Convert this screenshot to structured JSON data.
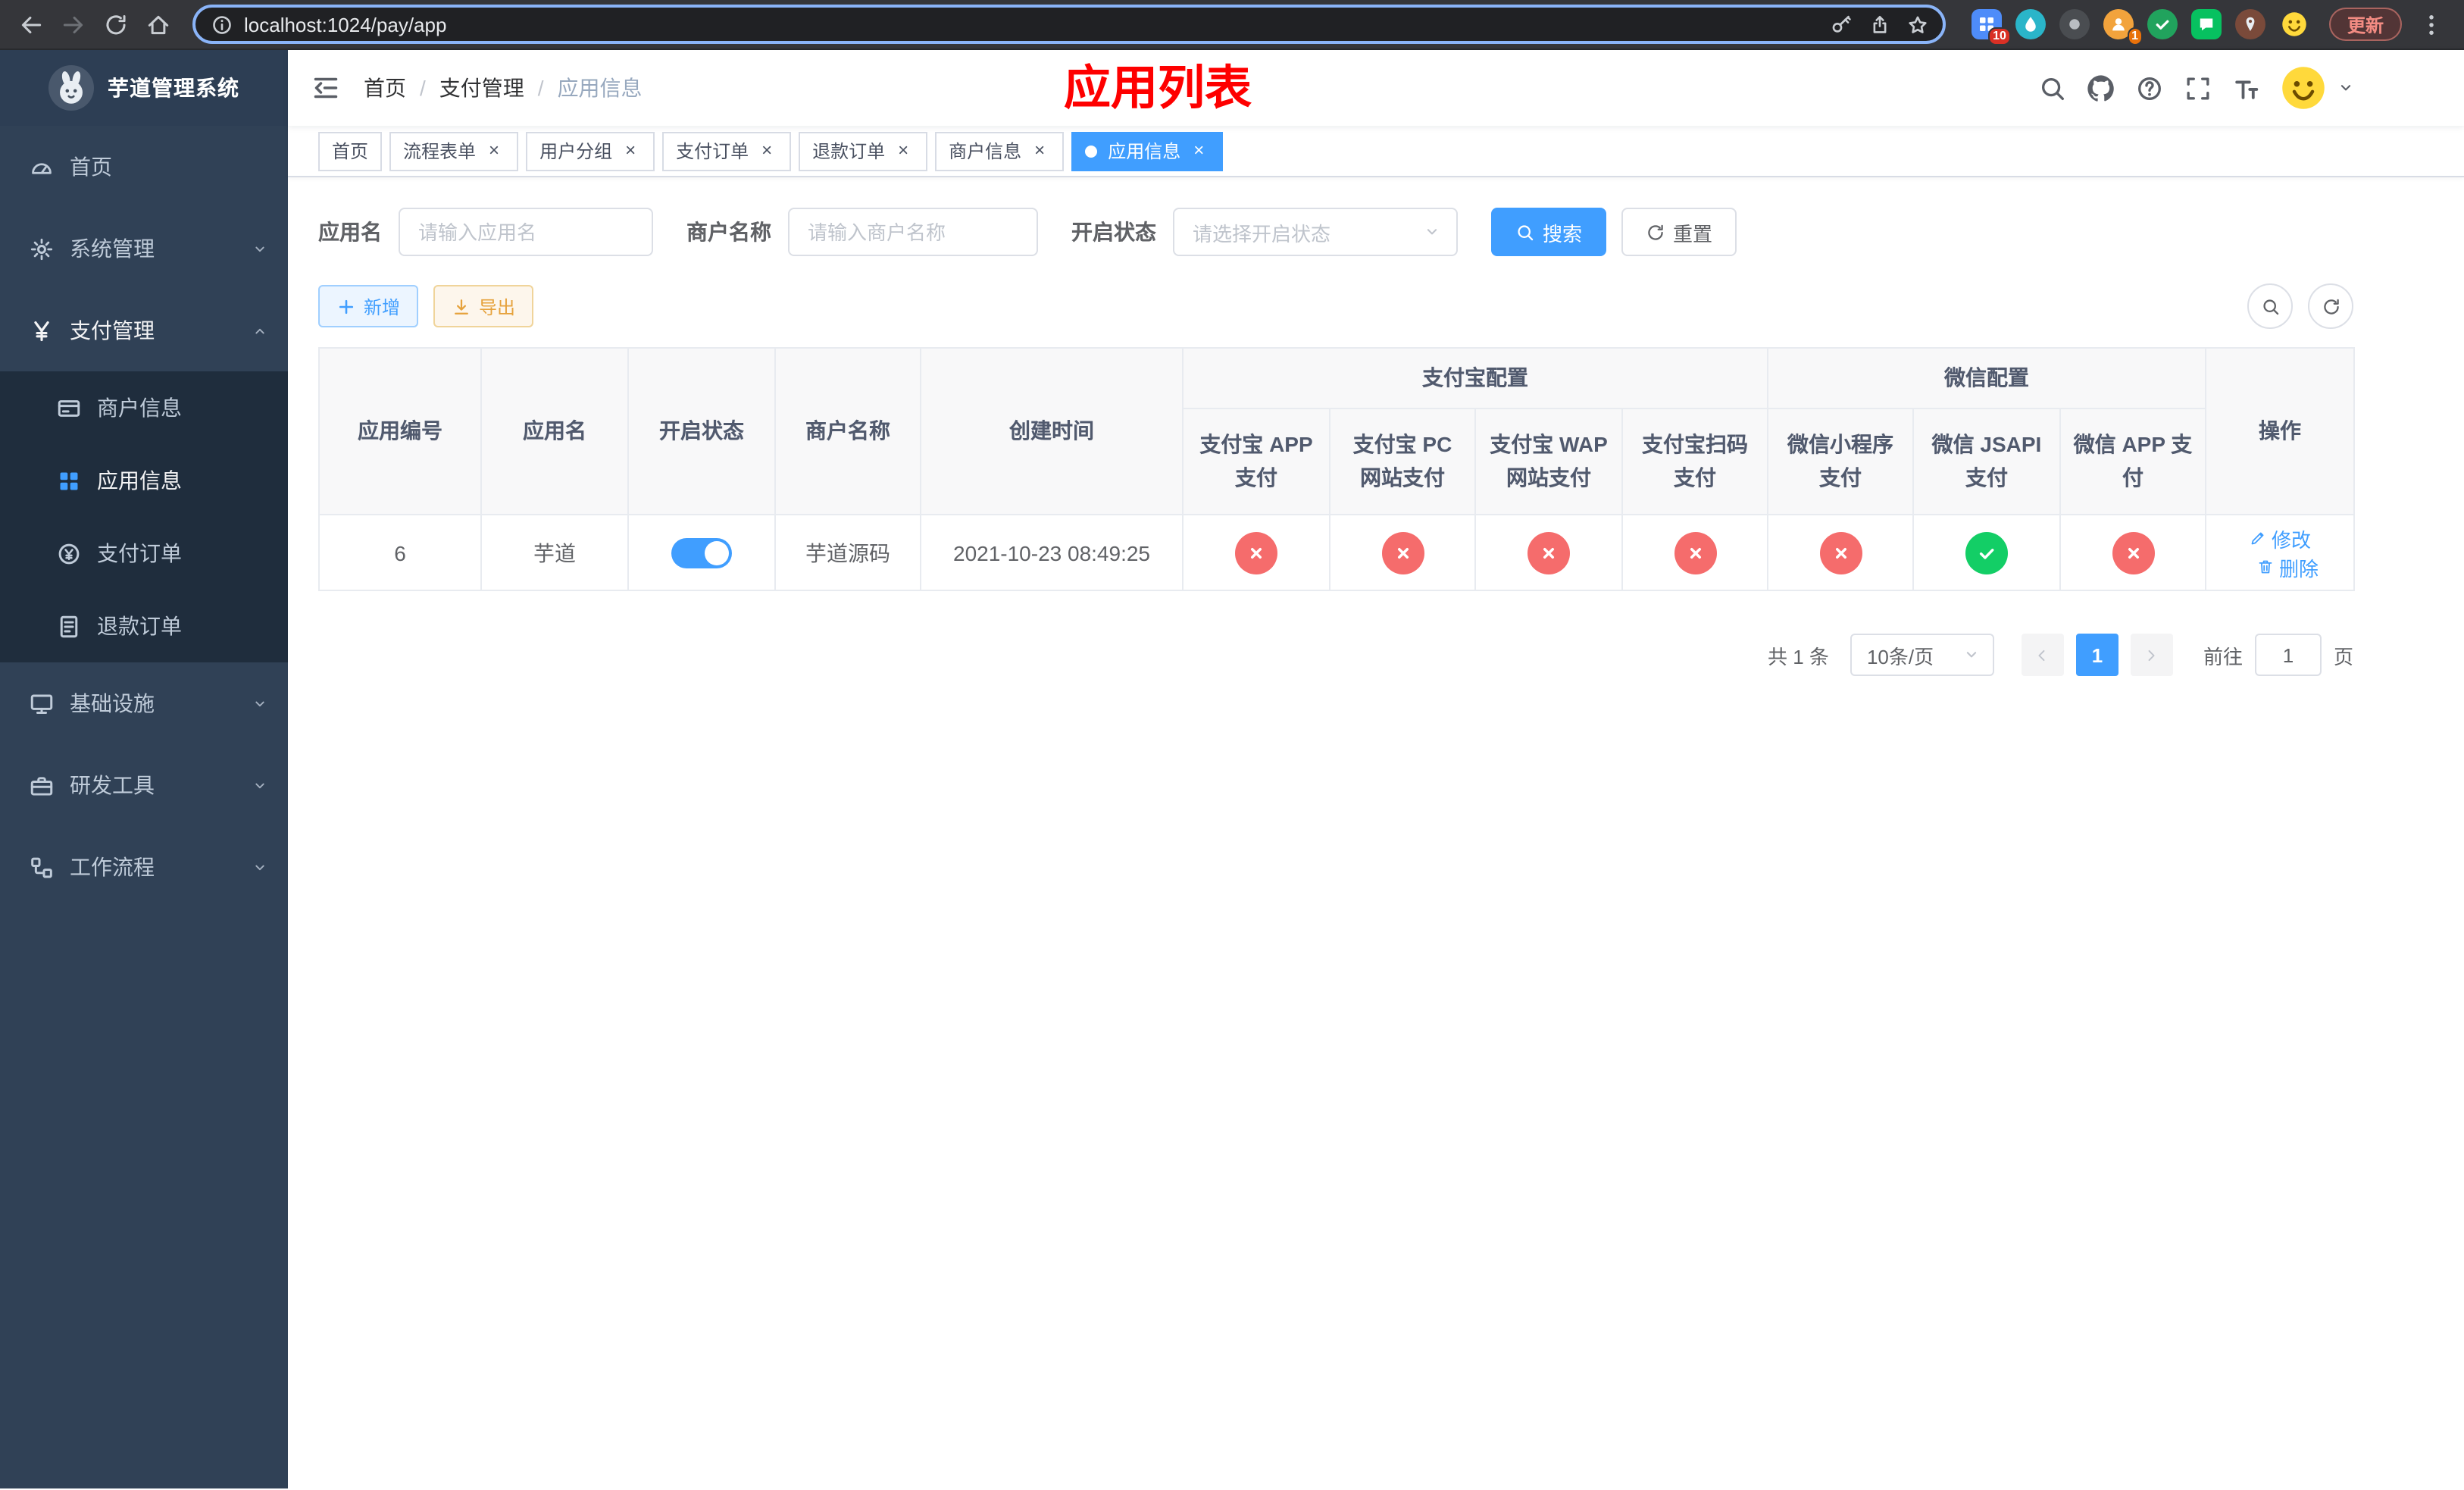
{
  "browser": {
    "url": "localhost:1024/pay/app",
    "update_label": "更新",
    "extensions": [
      {
        "id": "grid",
        "color": "#4e8cf9",
        "shape": "square",
        "badge": "10",
        "badge_color": "#d93025"
      },
      {
        "id": "drop",
        "color": "#2ab5c9",
        "shape": "circle"
      },
      {
        "id": "dark",
        "color": "#4a4d51",
        "shape": "circle"
      },
      {
        "id": "avatar",
        "color": "#f2a33c",
        "shape": "circle",
        "badge": "1",
        "badge_color": "#e8710a"
      },
      {
        "id": "check",
        "color": "#21a35d",
        "shape": "circle"
      },
      {
        "id": "chat",
        "color": "#07c160",
        "shape": "square"
      },
      {
        "id": "pin",
        "color": "#7a4a3a",
        "shape": "circle"
      },
      {
        "id": "smiley",
        "color": "transparent",
        "shape": "circle"
      }
    ]
  },
  "sidebar": {
    "logo_title": "芋道管理系统",
    "items": [
      {
        "id": "home",
        "label": "首页",
        "icon": "dashboard",
        "type": "item"
      },
      {
        "id": "system",
        "label": "系统管理",
        "icon": "gear",
        "type": "group",
        "expanded": false
      },
      {
        "id": "payment",
        "label": "支付管理",
        "icon": "yen",
        "type": "group",
        "expanded": true,
        "children": [
          {
            "id": "merchant-info",
            "label": "商户信息",
            "icon": "card",
            "active": false
          },
          {
            "id": "app-info",
            "label": "应用信息",
            "icon": "grid",
            "active": true
          },
          {
            "id": "pay-order",
            "label": "支付订单",
            "icon": "order",
            "active": false
          },
          {
            "id": "refund-order",
            "label": "退款订单",
            "icon": "doc",
            "active": false
          }
        ]
      },
      {
        "id": "infra",
        "label": "基础设施",
        "icon": "monitor",
        "type": "group",
        "expanded": false
      },
      {
        "id": "devtools",
        "label": "研发工具",
        "icon": "tool",
        "type": "group",
        "expanded": false
      },
      {
        "id": "workflow",
        "label": "工作流程",
        "icon": "flow",
        "type": "group",
        "expanded": false
      }
    ]
  },
  "header": {
    "breadcrumb": [
      "首页",
      "支付管理",
      "应用信息"
    ],
    "separator": "/",
    "page_title": "应用列表"
  },
  "tabs": [
    {
      "id": "home",
      "label": "首页",
      "closable": false,
      "active": false
    },
    {
      "id": "process-form",
      "label": "流程表单",
      "closable": true,
      "active": false
    },
    {
      "id": "user-group",
      "label": "用户分组",
      "closable": true,
      "active": false
    },
    {
      "id": "pay-order",
      "label": "支付订单",
      "closable": true,
      "active": false
    },
    {
      "id": "refund-order",
      "label": "退款订单",
      "closable": true,
      "active": false
    },
    {
      "id": "merchant-info",
      "label": "商户信息",
      "closable": true,
      "active": false
    },
    {
      "id": "app-info",
      "label": "应用信息",
      "closable": true,
      "active": true
    }
  ],
  "filters": {
    "app_name_label": "应用名",
    "app_name_placeholder": "请输入应用名",
    "merchant_label": "商户名称",
    "merchant_placeholder": "请输入商户名称",
    "status_label": "开启状态",
    "status_placeholder": "请选择开启状态",
    "search_label": "搜索",
    "reset_label": "重置"
  },
  "toolbar": {
    "add_label": "新增",
    "export_label": "导出"
  },
  "table": {
    "columns": {
      "id": "应用编号",
      "name": "应用名",
      "status": "开启状态",
      "merchant": "商户名称",
      "created": "创建时间",
      "alipay_group": "支付宝配置",
      "wechat_group": "微信配置",
      "alipay_app": "支付宝 APP 支付",
      "alipay_pc": "支付宝 PC 网站支付",
      "alipay_wap": "支付宝 WAP 网站支付",
      "alipay_scan": "支付宝扫码支付",
      "wx_mini": "微信小程序支付",
      "wx_jsapi": "微信 JSAPI 支付",
      "wx_app": "微信 APP 支付",
      "actions": "操作"
    },
    "rows": [
      {
        "id": "6",
        "name": "芋道",
        "enabled": true,
        "merchant": "芋道源码",
        "created": "2021-10-23 08:49:25",
        "config_values": [
          false,
          false,
          false,
          false,
          false,
          true,
          false
        ],
        "edit_label": "修改",
        "delete_label": "删除"
      }
    ]
  },
  "pagination": {
    "total_label": "共 1 条",
    "page_size_label": "10条/页",
    "current_page": "1",
    "goto_label": "前往",
    "goto_value": "1",
    "page_unit_label": "页"
  },
  "colors": {
    "primary": "#409eff",
    "success": "#13ce66",
    "danger": "#f56c6c",
    "warning": "#e6a23c",
    "sidebar_bg": "#304156",
    "submenu_bg": "#1f2d3d",
    "page_title_red": "#fe0000",
    "active_tab": "#409eff"
  }
}
